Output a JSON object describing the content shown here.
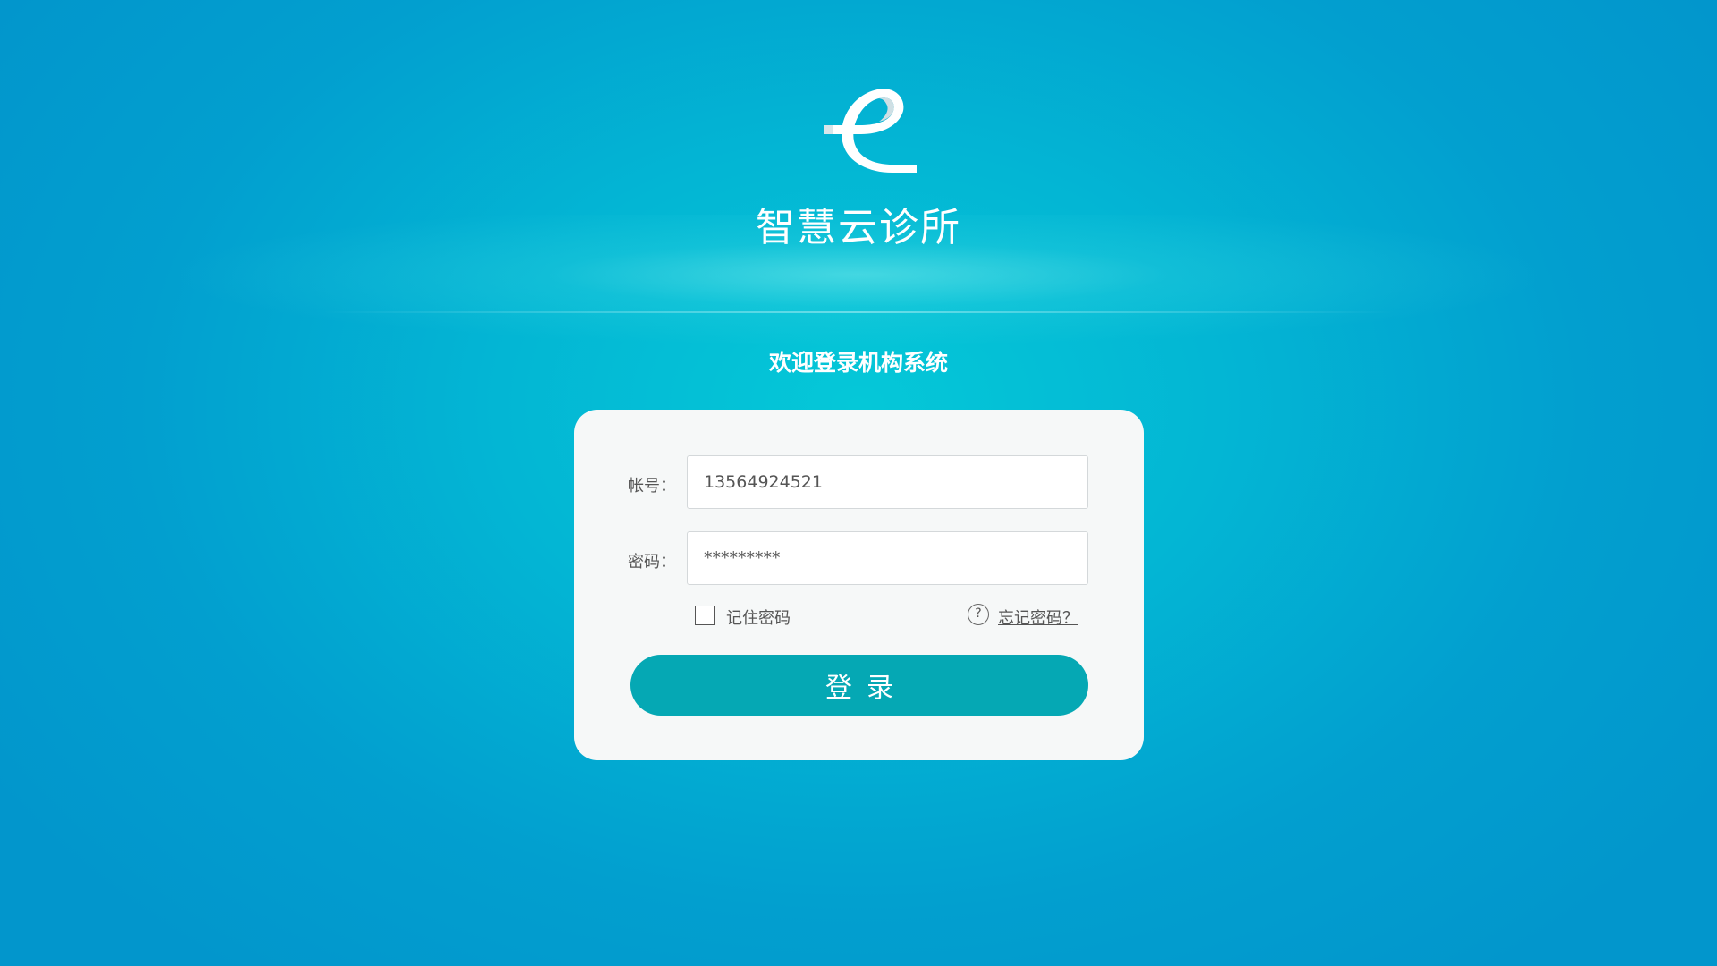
{
  "brand": {
    "logo_icon": "e-ribbon-logo-icon",
    "name": "智慧云诊所"
  },
  "welcome_text": "欢迎登录机构系统",
  "login_form": {
    "account_label": "帐号：",
    "account_value": "13564924521",
    "password_label": "密码：",
    "password_value": "*********",
    "remember_label": "记住密码",
    "remember_checked": false,
    "help_icon": "question-circle-icon",
    "help_glyph": "?",
    "forgot_label": "忘记密码？",
    "submit_label": "登录"
  },
  "colors": {
    "background": "#02a6d2",
    "card": "#f6f8f8",
    "button": "#05a8b4",
    "text": "#555555"
  }
}
